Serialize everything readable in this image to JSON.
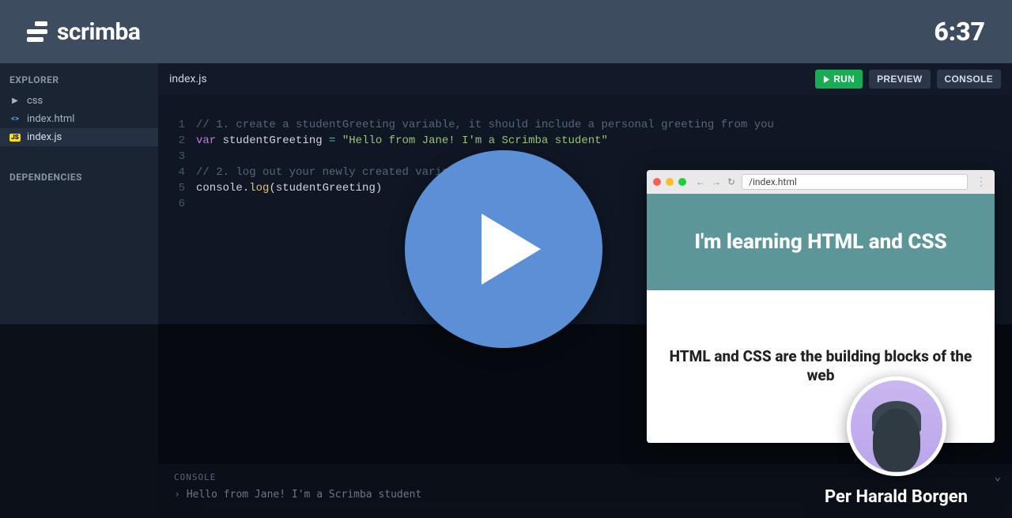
{
  "brand": "scrimba",
  "timestamp": "6:37",
  "sidebar": {
    "explorer_label": "EXPLORER",
    "dependencies_label": "DEPENDENCIES",
    "items": [
      {
        "label": "css",
        "icon": "▶",
        "type": "folder"
      },
      {
        "label": "index.html",
        "icon": "<>",
        "type": "html"
      },
      {
        "label": "index.js",
        "icon": "JS",
        "type": "js",
        "active": true
      }
    ]
  },
  "editor": {
    "filename": "index.js",
    "buttons": {
      "run": "RUN",
      "preview": "PREVIEW",
      "console": "CONSOLE"
    },
    "code_lines": [
      {
        "n": 1,
        "segments": [
          {
            "t": "// 1. create a studentGreeting variable, it should include a personal greeting from you",
            "c": "tok-comment"
          }
        ]
      },
      {
        "n": 2,
        "segments": [
          {
            "t": "var",
            "c": "tok-kw"
          },
          {
            "t": " studentGreeting ",
            "c": "tok-id"
          },
          {
            "t": "=",
            "c": "tok-op"
          },
          {
            "t": " ",
            "c": ""
          },
          {
            "t": "\"Hello from Jane! I'm a Scrimba student\"",
            "c": "tok-str"
          }
        ]
      },
      {
        "n": 3,
        "segments": [
          {
            "t": "",
            "c": ""
          }
        ]
      },
      {
        "n": 4,
        "segments": [
          {
            "t": "// 2. log out your newly created variable",
            "c": "tok-comment"
          }
        ]
      },
      {
        "n": 5,
        "segments": [
          {
            "t": "console",
            "c": "tok-id"
          },
          {
            "t": ".",
            "c": "tok-id"
          },
          {
            "t": "log",
            "c": "tok-fn"
          },
          {
            "t": "(",
            "c": "tok-id"
          },
          {
            "t": "studentGreeting",
            "c": "tok-id"
          },
          {
            "t": ")",
            "c": "tok-id"
          }
        ]
      },
      {
        "n": 6,
        "segments": [
          {
            "t": "",
            "c": ""
          }
        ]
      }
    ]
  },
  "console": {
    "label": "CONSOLE",
    "output": "Hello from Jane! I'm a Scrimba student"
  },
  "browser": {
    "url": "/index.html",
    "hero": "I'm learning HTML and CSS",
    "sub": "HTML and CSS are the building blocks of the web"
  },
  "instructor": {
    "name": "Per Harald Borgen"
  }
}
